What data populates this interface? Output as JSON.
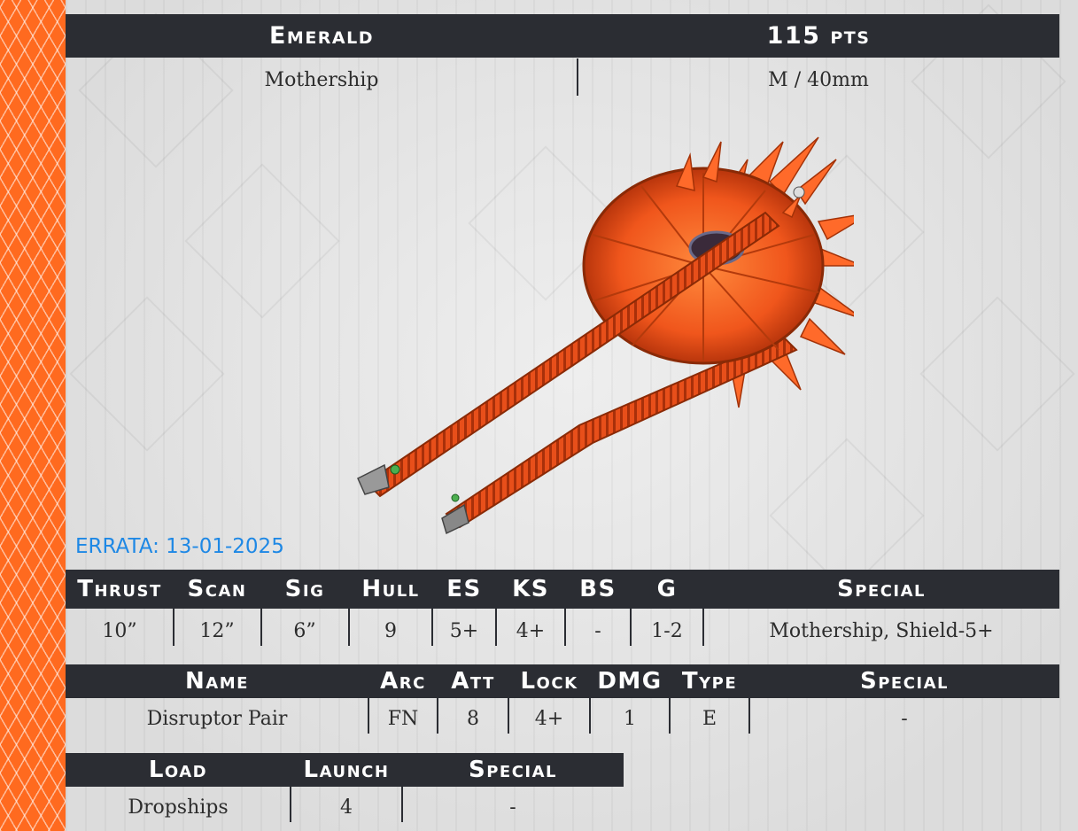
{
  "header": {
    "name": "Emerald",
    "points": "115 pts",
    "class": "Mothership",
    "size_base": "M / 40mm"
  },
  "errata": "ERRATA: 13-01-2025",
  "stats": {
    "headers": [
      "Thrust",
      "Scan",
      "Sig",
      "Hull",
      "ES",
      "KS",
      "BS",
      "G",
      "Special"
    ],
    "values": [
      "10”",
      "12”",
      "6”",
      "9",
      "5+",
      "4+",
      "-",
      "1-2",
      "Mothership, Shield-5+"
    ]
  },
  "weapons": {
    "headers": [
      "Name",
      "Arc",
      "Att",
      "Lock",
      "DMG",
      "Type",
      "Special"
    ],
    "rows": [
      [
        "Disruptor Pair",
        "FN",
        "8",
        "4+",
        "1",
        "E",
        "-"
      ]
    ]
  },
  "launch": {
    "headers": [
      "Load",
      "Launch",
      "Special"
    ],
    "rows": [
      [
        "Dropships",
        "4",
        "-"
      ]
    ]
  },
  "image": {
    "subject": "orange-alien-mothership-miniature",
    "accent_color": "#ff6a1f"
  }
}
